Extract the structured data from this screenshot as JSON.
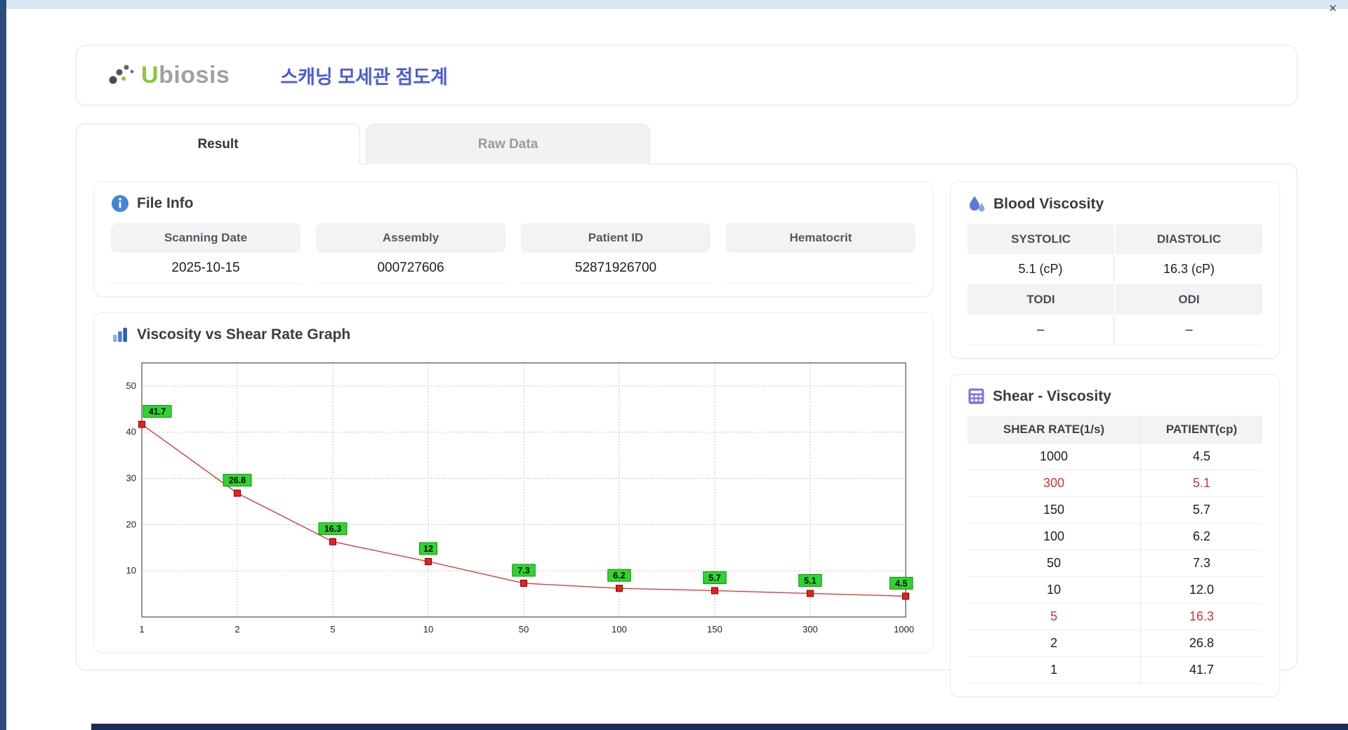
{
  "window": {
    "close_label": "×"
  },
  "header": {
    "brand_u": "U",
    "brand_rest": "biosis",
    "title": "스캐닝 모세관 점도계"
  },
  "tabs": [
    {
      "label": "Result",
      "active": true
    },
    {
      "label": "Raw Data",
      "active": false
    }
  ],
  "file_info": {
    "title": "File Info",
    "fields": [
      {
        "name": "scanning-date",
        "label": "Scanning Date",
        "value": "2025-10-15"
      },
      {
        "name": "assembly",
        "label": "Assembly",
        "value": "000727606"
      },
      {
        "name": "patient-id",
        "label": "Patient ID",
        "value": "52871926700"
      },
      {
        "name": "hematocrit",
        "label": "Hematocrit",
        "value": ""
      }
    ]
  },
  "blood_viscosity": {
    "title": "Blood Viscosity",
    "cells": [
      {
        "label": "SYSTOLIC",
        "value": "5.1 (cP)"
      },
      {
        "label": "DIASTOLIC",
        "value": "16.3 (cP)"
      },
      {
        "label": "TODI",
        "value": "–"
      },
      {
        "label": "ODI",
        "value": "–"
      }
    ]
  },
  "shear_table": {
    "title": "Shear - Viscosity",
    "columns": [
      "SHEAR RATE(1/s)",
      "PATIENT(cp)"
    ],
    "highlight_color": "#cf3434",
    "rows": [
      {
        "shear": "1000",
        "patient": "4.5",
        "highlight": false
      },
      {
        "shear": "300",
        "patient": "5.1",
        "highlight": true
      },
      {
        "shear": "150",
        "patient": "5.7",
        "highlight": false
      },
      {
        "shear": "100",
        "patient": "6.2",
        "highlight": false
      },
      {
        "shear": "50",
        "patient": "7.3",
        "highlight": false
      },
      {
        "shear": "10",
        "patient": "12.0",
        "highlight": false
      },
      {
        "shear": "5",
        "patient": "16.3",
        "highlight": true
      },
      {
        "shear": "2",
        "patient": "26.8",
        "highlight": false
      },
      {
        "shear": "1",
        "patient": "41.7",
        "highlight": false
      }
    ]
  },
  "chart_data": {
    "type": "line",
    "title": "Viscosity vs Shear Rate Graph",
    "x": [
      1,
      2,
      5,
      10,
      50,
      100,
      150,
      300,
      1000
    ],
    "x_scale": "categorical",
    "values": [
      41.7,
      26.8,
      16.3,
      12,
      7.3,
      6.2,
      5.7,
      5.1,
      4.5
    ],
    "point_labels": [
      "41.7",
      "26.8",
      "16.3",
      "12",
      "7.3",
      "6.2",
      "5.7",
      "5.1",
      "4.5"
    ],
    "yticks": [
      10,
      20,
      30,
      40,
      50
    ],
    "ylim": [
      0,
      55
    ],
    "grid": true,
    "legend": false,
    "line_color": "#d04040",
    "marker_color": "#e82020",
    "marker_border": "#7a0000",
    "label_bg": "#2fd52f",
    "label_border": "#0f8f0f"
  }
}
